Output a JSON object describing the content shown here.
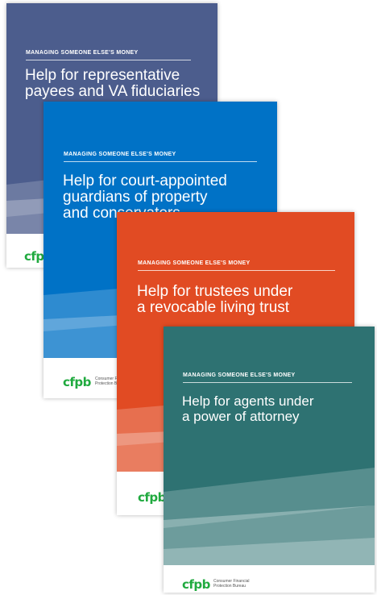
{
  "booklets": [
    {
      "series": "MANAGING SOMEONE ELSE'S MONEY",
      "title_line1": "Help for representative",
      "title_line2": "payees and VA fiduciaries",
      "title_line3": "",
      "color": "#4c5d8d"
    },
    {
      "series": "MANAGING SOMEONE ELSE'S MONEY",
      "title_line1": "Help for court-appointed",
      "title_line2": "guardians of property",
      "title_line3": "and conservators",
      "color": "#0072c6"
    },
    {
      "series": "MANAGING SOMEONE ELSE'S MONEY",
      "title_line1": "Help for trustees under",
      "title_line2": "a revocable living trust",
      "title_line3": "",
      "color": "#e14b23"
    },
    {
      "series": "MANAGING SOMEONE ELSE'S MONEY",
      "title_line1": "Help for agents under",
      "title_line2": "a power of attorney",
      "title_line3": "",
      "color": "#2e7272"
    }
  ],
  "logo": {
    "wordmark": "cfpb",
    "agency_line1": "Consumer Financial",
    "agency_line2": "Protection Bureau",
    "color": "#20aa3f"
  }
}
